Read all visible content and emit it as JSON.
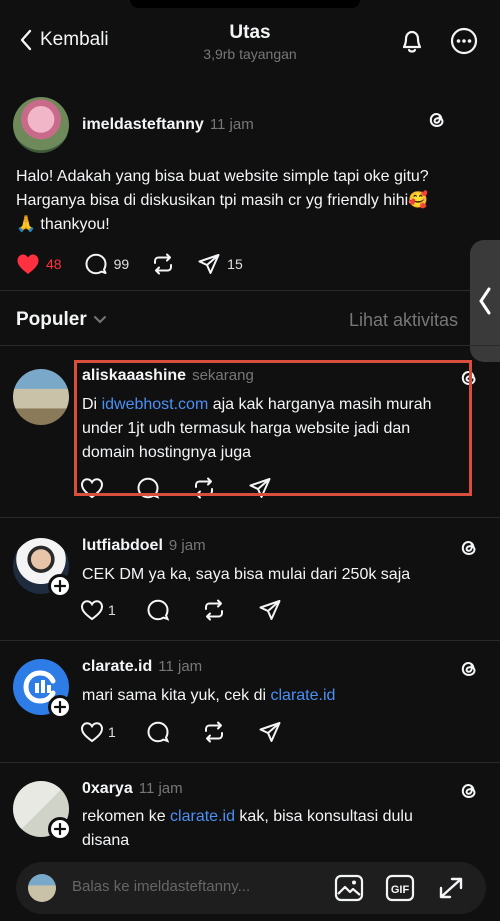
{
  "header": {
    "back_label": "Kembali",
    "title": "Utas",
    "subtitle": "3,9rb tayangan"
  },
  "post": {
    "username": "imeldasteftanny",
    "time": "11 jam",
    "text_line1": "Halo! Adakah yang bisa buat website simple tapi oke gitu?",
    "text_line2": "Harganya bisa di diskusikan tpi masih cr yg friendly hihi🥰",
    "text_line3": "🙏 thankyou!",
    "likes": "48",
    "comments": "99",
    "shares": "15"
  },
  "filter": {
    "sort_label": "Populer",
    "activity_link": "Lihat aktivitas"
  },
  "replies": [
    {
      "username": "aliskaaashine",
      "time": "sekarang",
      "text_pre": "Di ",
      "text_link": "idwebhost.com",
      "text_post1": " aja kak harganya masih murah",
      "text_line2": "under 1jt udh termasuk harga website jadi dan",
      "text_line3": "domain hostingnya juga"
    },
    {
      "username": "lutfiabdoel",
      "time": "9 jam",
      "text": "CEK DM ya ka, saya bisa mulai dari 250k saja",
      "likes": "1"
    },
    {
      "username": "clarate.id",
      "time": "11 jam",
      "text_pre": "mari sama kita yuk, cek di ",
      "text_link": "clarate.id",
      "likes": "1"
    },
    {
      "username": "0xarya",
      "time": "11 jam",
      "text_pre": "rekomen ke ",
      "text_link": "clarate.id",
      "text_post": " kak, bisa konsultasi dulu",
      "text_line2": "disana"
    }
  ],
  "reply_bar": {
    "placeholder": "Balas ke imeldasteftanny..."
  },
  "colors": {
    "background": "#101010",
    "like_red": "#ff3040",
    "link_blue": "#4a90f5",
    "highlight_border": "#d94f3b"
  }
}
